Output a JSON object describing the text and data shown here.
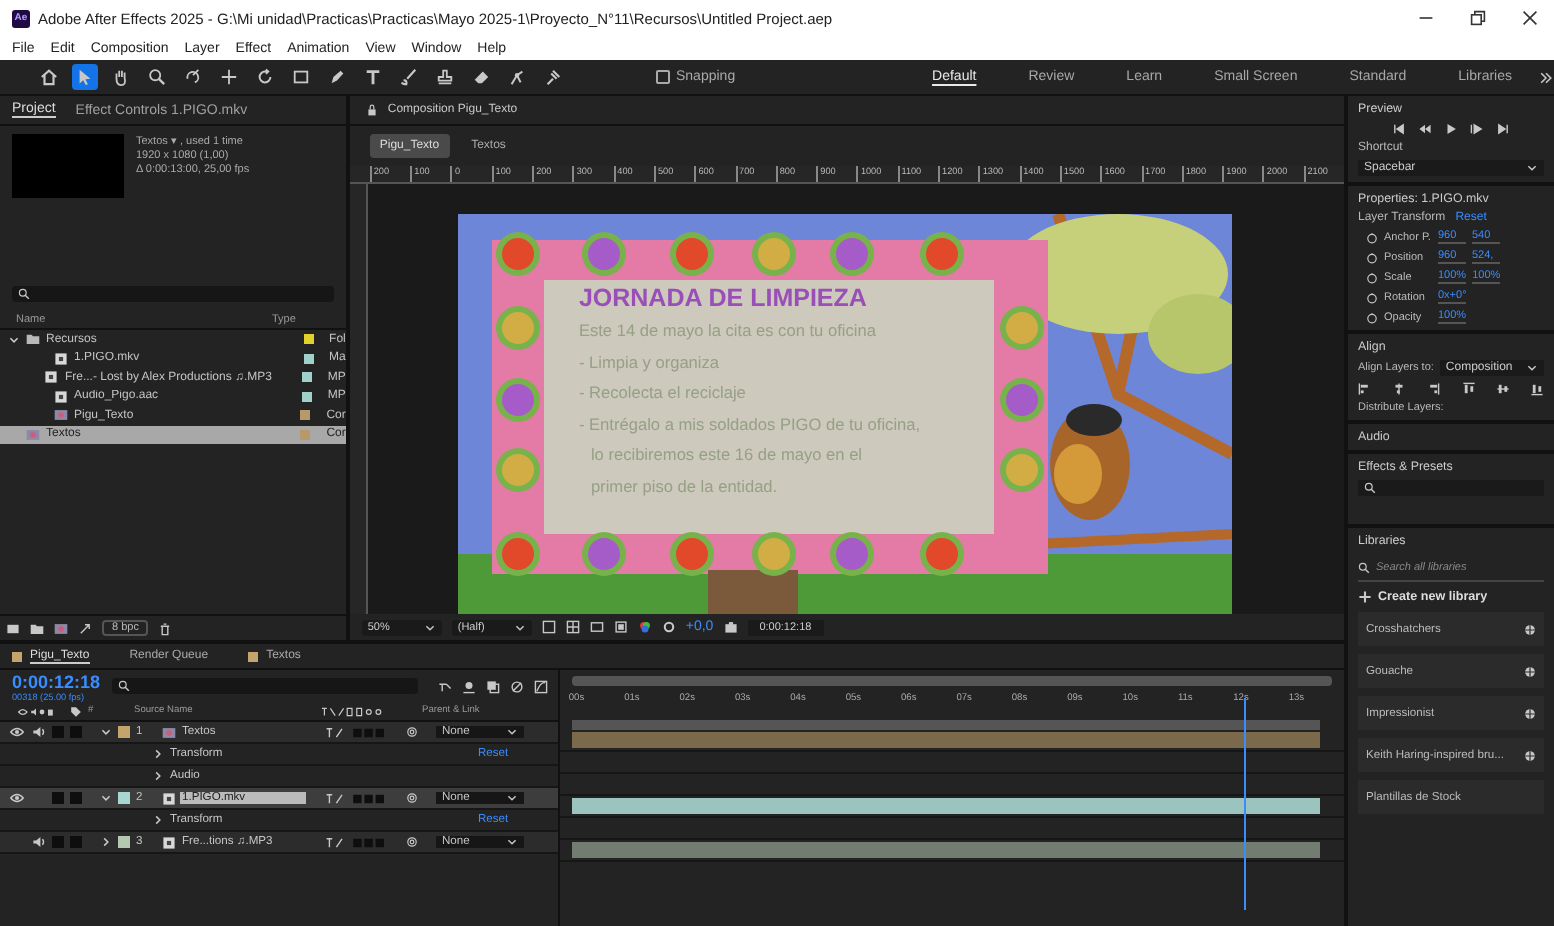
{
  "window": {
    "logo": "Ae",
    "title": "Adobe After Effects 2025 - G:\\Mi unidad\\Practicas\\Practicas\\Mayo 2025-1\\Proyecto_N°11\\Recursos\\Untitled Project.aep"
  },
  "menu": [
    "File",
    "Edit",
    "Composition",
    "Layer",
    "Effect",
    "Animation",
    "View",
    "Window",
    "Help"
  ],
  "toolbar": {
    "tools": [
      {
        "kind": "home",
        "selected": false
      },
      {
        "kind": "select",
        "selected": true
      },
      {
        "kind": "hand",
        "selected": false
      },
      {
        "kind": "zoom",
        "selected": false
      },
      {
        "kind": "orbit",
        "selected": false
      },
      {
        "kind": "move",
        "selected": false
      },
      {
        "kind": "rotate",
        "selected": false
      },
      {
        "kind": "rect",
        "selected": false
      },
      {
        "kind": "pen",
        "selected": false
      },
      {
        "kind": "type",
        "selected": false
      },
      {
        "kind": "brush",
        "selected": false
      },
      {
        "kind": "stamp",
        "selected": false
      },
      {
        "kind": "eraser",
        "selected": false
      },
      {
        "kind": "puppet",
        "selected": false
      },
      {
        "kind": "pin",
        "selected": false
      }
    ],
    "snapping": {
      "label": "Snapping",
      "checked": false
    },
    "workspaces": [
      {
        "label": "Default",
        "selected": true
      },
      {
        "label": "Review",
        "selected": false
      },
      {
        "label": "Learn",
        "selected": false
      },
      {
        "label": "Small Screen",
        "selected": false
      },
      {
        "label": "Standard",
        "selected": false
      },
      {
        "label": "Libraries",
        "selected": false
      }
    ]
  },
  "project": {
    "tabs": [
      {
        "label": "Project",
        "selected": true
      },
      {
        "label": "Effect Controls 1.PIGO.mkv",
        "selected": false
      }
    ],
    "info": [
      "Textos ▾ , used 1 time",
      "1920 x 1080 (1,00)",
      "Δ 0:00:13:00, 25,00 fps"
    ],
    "columns": [
      "Name",
      "Type"
    ],
    "items": [
      {
        "name": "Recursos",
        "kind": "folder",
        "type": "Fol",
        "color": "#e2d12c",
        "expanded": true,
        "selected": false,
        "children": [
          {
            "name": "1.PIGO.mkv",
            "kind": "footage",
            "type": "Ma",
            "color": "#9fd0ca",
            "selected": false
          },
          {
            "name": "Fre...- Lost by Alex Productions ♫.MP3",
            "kind": "audio",
            "type": "MP",
            "color": "#9fd0ca",
            "selected": false
          },
          {
            "name": "Audio_Pigo.aac",
            "kind": "footage",
            "type": "MP",
            "color": "#9fd0ca",
            "selected": false
          },
          {
            "name": "Pigu_Texto",
            "kind": "comp",
            "type": "Cor",
            "color": "#b89a6a",
            "selected": false
          }
        ]
      },
      {
        "name": "Textos",
        "kind": "comp",
        "type": "Cor",
        "color": "#b89a6a",
        "selected": true
      }
    ],
    "bpc": "8 bpc"
  },
  "composition": {
    "tab": "Composition Pigu_Texto",
    "breadcrumbs": [
      {
        "label": "Pigu_Texto",
        "selected": true
      },
      {
        "label": "Textos",
        "selected": false
      }
    ],
    "ruler": [
      "200",
      "100",
      "0",
      "100",
      "200",
      "300",
      "400",
      "500",
      "600",
      "700",
      "800",
      "900",
      "1000",
      "1100",
      "1200",
      "1300",
      "1400",
      "1500",
      "1600",
      "1700",
      "1800",
      "1900",
      "2000",
      "2100"
    ],
    "text_layer": {
      "title": "JORNADA DE LIMPIEZA",
      "lines": [
        {
          "text": "Este 14 de mayo la cita es con tu oficina",
          "kind": "plain"
        },
        {
          "text": "- Limpia y organiza",
          "kind": "bullet"
        },
        {
          "text": "- Recolecta el reciclaje",
          "kind": "bullet"
        },
        {
          "text": "- Entrégalo a mis soldados PIGO de tu oficina,",
          "kind": "bullet"
        },
        {
          "text": "lo recibiremos este 16 de mayo en  el",
          "kind": "continuation"
        },
        {
          "text": "primer piso de la entidad.",
          "kind": "continuation"
        }
      ]
    },
    "zoom": "50%",
    "resolution": "(Half)",
    "exposure": "+0,0",
    "time": "0:00:12:18"
  },
  "preview": {
    "title": "Preview",
    "shortcut_label": "Shortcut",
    "shortcut": "Spacebar"
  },
  "properties": {
    "title": "Properties: 1.PIGO.mkv",
    "group": "Layer Transform",
    "reset": "Reset",
    "rows": [
      {
        "name": "Anchor P.",
        "values": [
          "960",
          "540"
        ]
      },
      {
        "name": "Position",
        "values": [
          "960",
          "524,"
        ]
      },
      {
        "name": "Scale",
        "values": [
          "100%",
          "100%"
        ]
      },
      {
        "name": "Rotation",
        "values": [
          "0x+0°"
        ]
      },
      {
        "name": "Opacity",
        "values": [
          "100%"
        ]
      }
    ]
  },
  "align": {
    "title": "Align",
    "label": "Align Layers to:",
    "target": "Composition",
    "distribute": "Distribute Layers:"
  },
  "audio": {
    "title": "Audio"
  },
  "effects": {
    "title": "Effects & Presets"
  },
  "libraries": {
    "title": "Libraries",
    "search_placeholder": "Search all libraries",
    "create": "Create new library",
    "items": [
      {
        "name": "Crosshatchers",
        "shared": true
      },
      {
        "name": "Gouache",
        "shared": true
      },
      {
        "name": "Impressionist",
        "shared": true
      },
      {
        "name": "Keith Haring-inspired bru...",
        "shared": true
      },
      {
        "name": "Plantillas de Stock",
        "shared": false
      }
    ]
  },
  "timeline": {
    "tabs": [
      {
        "label": "Pigu_Texto",
        "selected": true,
        "color": "#c2a46c"
      },
      {
        "label": "Render Queue",
        "selected": false
      },
      {
        "label": "Textos",
        "selected": false,
        "color": "#c2a46c"
      }
    ],
    "time": "0:00:12:18",
    "frame": "00318 (25.00 fps)",
    "columns": {
      "number": "#",
      "source": "Source Name",
      "parent": "Parent & Link"
    },
    "layers": [
      {
        "number": "1",
        "name": "Textos",
        "kind": "comp",
        "color": "#c2a46c",
        "video": true,
        "audio": true,
        "selected": false,
        "expanded": true,
        "parent": "None",
        "children": [
          {
            "name": "Transform",
            "reset": "Reset"
          },
          {
            "name": "Audio"
          }
        ]
      },
      {
        "number": "2",
        "name": "1.PIGO.mkv",
        "kind": "footage",
        "color": "#a8d6d0",
        "video": true,
        "audio": false,
        "selected": true,
        "expanded": true,
        "parent": "None",
        "children": [
          {
            "name": "Transform",
            "reset": "Reset"
          }
        ]
      },
      {
        "number": "3",
        "name": "Fre...tions ♫.MP3",
        "kind": "audio",
        "color": "#b5c7b3",
        "video": false,
        "audio": true,
        "selected": false,
        "expanded": false,
        "parent": "None"
      }
    ],
    "ruler": [
      "00s",
      "01s",
      "02s",
      "03s",
      "04s",
      "05s",
      "06s",
      "07s",
      "08s",
      "09s",
      "10s",
      "11s",
      "12s",
      "13s"
    ]
  }
}
